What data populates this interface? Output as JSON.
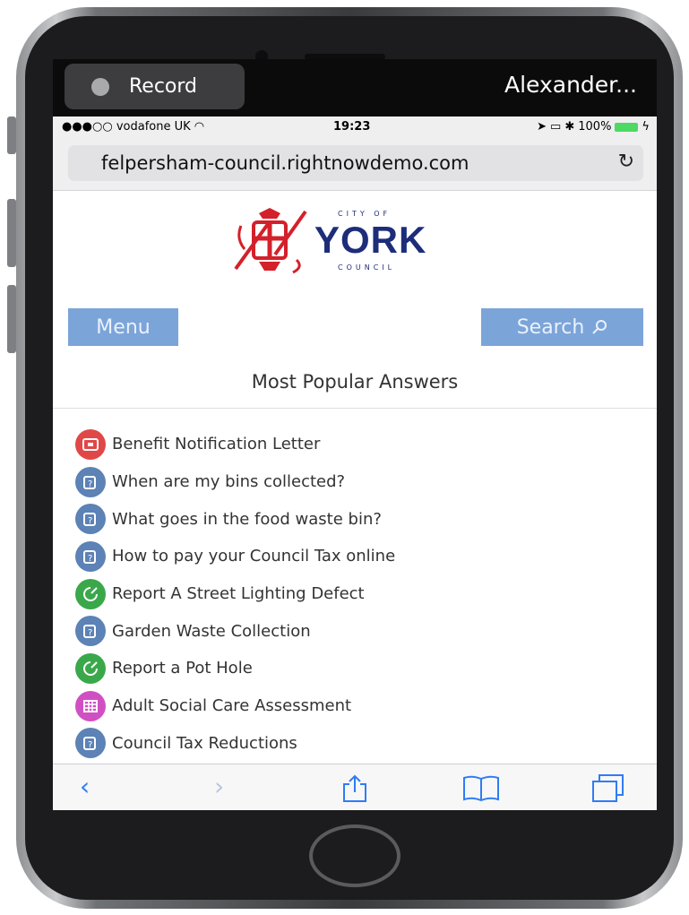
{
  "recorder": {
    "record_label": "Record",
    "user_name": "Alexander..."
  },
  "status_bar": {
    "carrier": "●●●○○ vodafone UK",
    "time": "19:23",
    "battery": "100%"
  },
  "browser": {
    "url": "felpersham-council.rightnowdemo.com"
  },
  "logo": {
    "city_of": "CITY OF",
    "york": "YORK",
    "council": "COUNCIL"
  },
  "nav": {
    "menu_label": "Menu",
    "search_label": "Search"
  },
  "section_title": "Most Popular Answers",
  "answers": [
    {
      "label": "Benefit Notification Letter",
      "icon": "letter-icon",
      "color": "#e04848"
    },
    {
      "label": "When are my bins collected?",
      "icon": "question-icon",
      "color": "#5c82b6"
    },
    {
      "label": "What goes in the food waste bin?",
      "icon": "question-icon",
      "color": "#5c82b6"
    },
    {
      "label": "How to pay your Council Tax online",
      "icon": "question-icon",
      "color": "#5c82b6"
    },
    {
      "label": "Report A Street Lighting Defect",
      "icon": "report-icon",
      "color": "#3aa84a"
    },
    {
      "label": "Garden Waste Collection",
      "icon": "question-icon",
      "color": "#5c82b6"
    },
    {
      "label": "Report a Pot Hole",
      "icon": "report-icon",
      "color": "#3aa84a"
    },
    {
      "label": "Adult Social Care Assessment",
      "icon": "form-icon",
      "color": "#d050c4"
    },
    {
      "label": "Council Tax Reductions",
      "icon": "question-icon",
      "color": "#5c82b6"
    }
  ],
  "colors": {
    "button_bg": "#7ba4d9",
    "logo_blue": "#1d2d7a",
    "logo_red": "#d4202a",
    "safari_blue": "#2f7cf6"
  }
}
